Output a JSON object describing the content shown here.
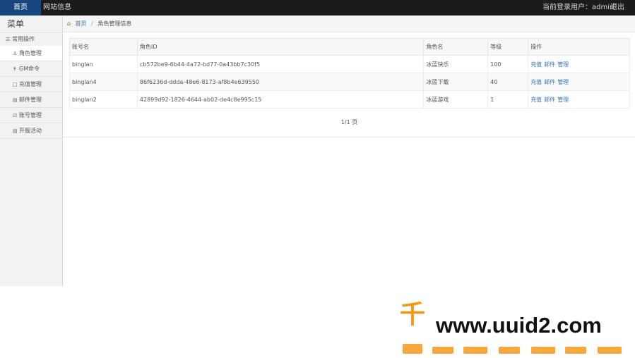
{
  "topbar": {
    "tabs": [
      {
        "label": "首页",
        "active": true
      },
      {
        "label": "网站信息",
        "active": false
      }
    ],
    "login_text": "当前登录用户：admin",
    "logout_label": "退出"
  },
  "sidebar": {
    "title": "菜单",
    "group_label": "常用操作",
    "items": [
      {
        "icon": "user-icon",
        "label": "角色管理",
        "active": true
      },
      {
        "icon": "wrench-icon",
        "label": "GM命令",
        "active": false
      },
      {
        "icon": "file-icon",
        "label": "充值管理",
        "active": false
      },
      {
        "icon": "list-icon",
        "label": "邮件管理",
        "active": false
      },
      {
        "icon": "check-icon",
        "label": "账号管理",
        "active": false
      },
      {
        "icon": "list-icon",
        "label": "开服活动",
        "active": false
      }
    ]
  },
  "breadcrumb": {
    "home": "首页",
    "current": "角色管理信息"
  },
  "table": {
    "columns": [
      "账号名",
      "角色ID",
      "角色名",
      "等级",
      "操作"
    ],
    "rows": [
      {
        "account": "binglan",
        "role_id": "cb572be9-6b44-4a72-bd77-0a43bb7c30f5",
        "role_name": "冰蓝快乐",
        "level": "100",
        "ops": [
          "充值",
          "邮件",
          "管理"
        ]
      },
      {
        "account": "binglan4",
        "role_id": "86f6236d-ddda-48e6-8173-af8b4e639550",
        "role_name": "冰蓝下载",
        "level": "40",
        "ops": [
          "充值",
          "邮件",
          "管理"
        ]
      },
      {
        "account": "binglan2",
        "role_id": "42899d92-1826-4644-ab02-de4c8e995c15",
        "role_name": "冰蓝游戏",
        "level": "1",
        "ops": [
          "充值",
          "邮件",
          "管理"
        ]
      }
    ]
  },
  "pager": {
    "text": "1/1 页"
  },
  "watermark": {
    "text": "www.uuid2.com",
    "glyph": "千"
  },
  "colors": {
    "accent": "#17467f",
    "link": "#3a76b5",
    "topbar": "#1b1b1b",
    "watermark_orange": "#f39a1c"
  }
}
